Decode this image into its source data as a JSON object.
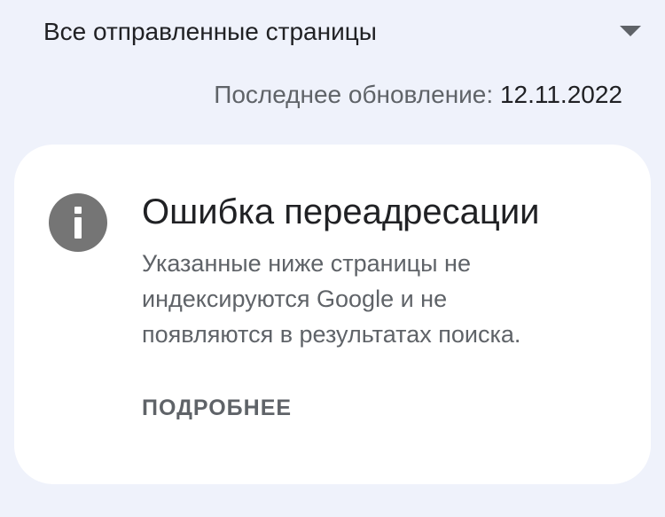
{
  "filter": {
    "selected": "Все отправленные страницы",
    "icon": "dropdown-arrow-icon"
  },
  "last_update": {
    "label": "Последнее обновление:",
    "date": "12.11.2022"
  },
  "issue_card": {
    "icon": "info-icon",
    "title": "Ошибка переадресации",
    "lines": [
      "Указанные ниже страницы не",
      "индексируются Google и не",
      "появляются в результатах поиска."
    ],
    "link_label": "ПОДРОБНЕЕ"
  }
}
